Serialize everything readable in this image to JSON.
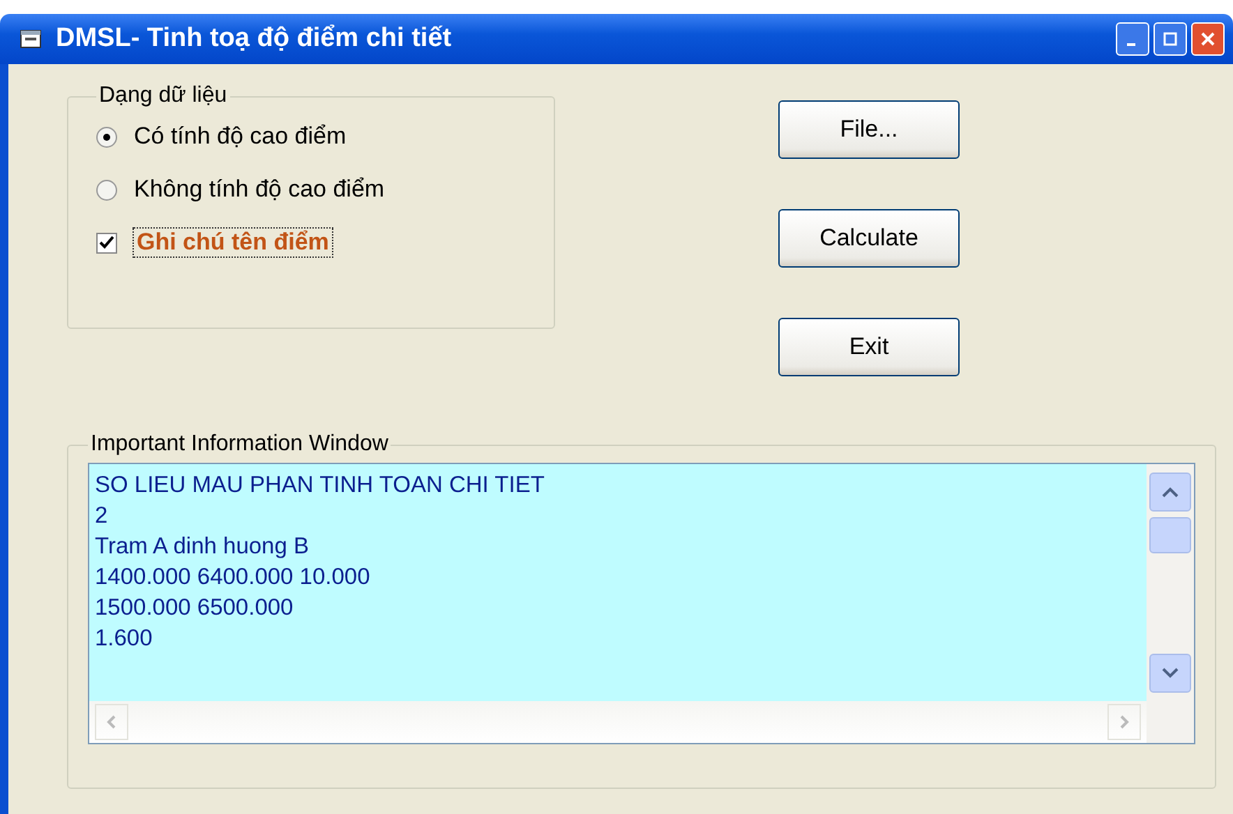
{
  "window": {
    "title": "DMSL- Tinh toạ độ điểm chi tiết"
  },
  "data_group": {
    "label": "Dạng dữ liệu",
    "options": [
      {
        "kind": "radio",
        "label": "Có tính độ cao điểm",
        "selected": true
      },
      {
        "kind": "radio",
        "label": "Không tính độ cao điểm",
        "selected": false
      },
      {
        "kind": "checkbox",
        "label": "Ghi chú tên điểm",
        "checked": true
      }
    ]
  },
  "buttons": [
    {
      "label": "File..."
    },
    {
      "label": "Calculate"
    },
    {
      "label": "Exit"
    }
  ],
  "info_group": {
    "label": "Important Information Window",
    "lines": [
      "SO LIEU MAU PHAN TINH TOAN CHI TIET",
      "2",
      "Tram A dinh huong B",
      "1400.000 6400.000 10.000",
      "1500.000 6500.000",
      "1.600"
    ]
  }
}
